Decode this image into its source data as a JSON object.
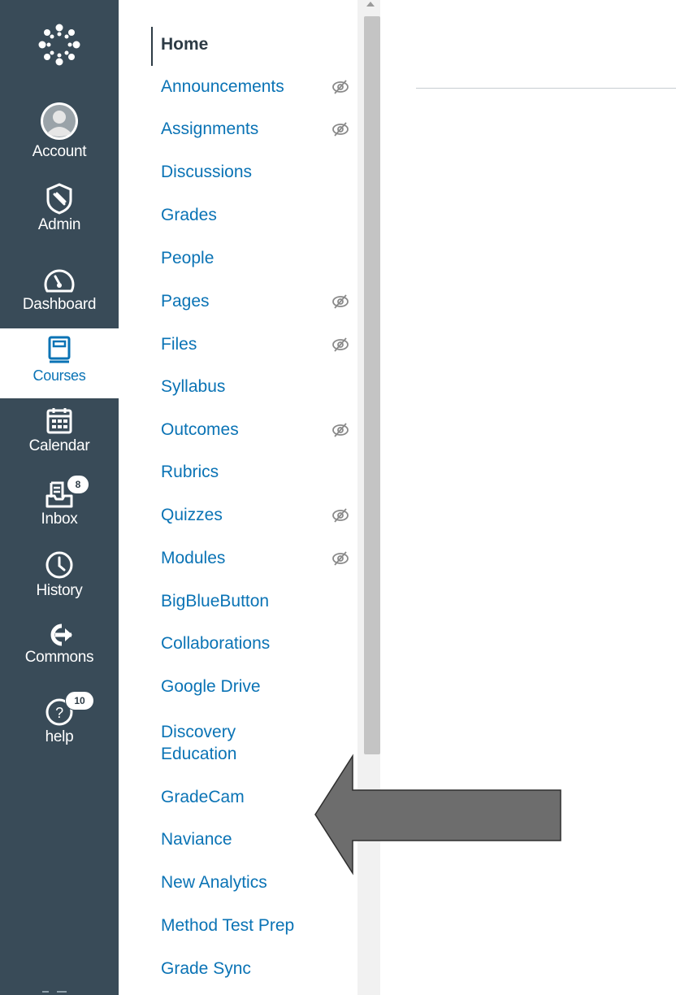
{
  "global_nav": {
    "items": [
      {
        "label": ""
      },
      {
        "label": "Account"
      },
      {
        "label": "Admin"
      },
      {
        "label": "Dashboard"
      },
      {
        "label": "Courses"
      },
      {
        "label": "Calendar"
      },
      {
        "label": "Inbox",
        "badge": "8"
      },
      {
        "label": "History"
      },
      {
        "label": "Commons"
      },
      {
        "label": "help",
        "badge": "10"
      }
    ],
    "colors": {
      "background": "#394b58",
      "active_bg": "#ffffff",
      "active_text": "#0a73b5"
    }
  },
  "course_nav": {
    "items": [
      {
        "label": "Home",
        "active": true,
        "hidden": false
      },
      {
        "label": "Announcements",
        "hidden": true
      },
      {
        "label": "Assignments",
        "hidden": true
      },
      {
        "label": "Discussions",
        "hidden": false
      },
      {
        "label": "Grades",
        "hidden": false
      },
      {
        "label": "People",
        "hidden": false
      },
      {
        "label": "Pages",
        "hidden": true
      },
      {
        "label": "Files",
        "hidden": true
      },
      {
        "label": "Syllabus",
        "hidden": false
      },
      {
        "label": "Outcomes",
        "hidden": true
      },
      {
        "label": "Rubrics",
        "hidden": false
      },
      {
        "label": "Quizzes",
        "hidden": true
      },
      {
        "label": "Modules",
        "hidden": true
      },
      {
        "label": "BigBlueButton",
        "hidden": false
      },
      {
        "label": "Collaborations",
        "hidden": false
      },
      {
        "label": "Google Drive",
        "hidden": false
      },
      {
        "label": "Discovery",
        "hidden": false
      },
      {
        "label": "Education",
        "hidden": false
      },
      {
        "label": "GradeCam",
        "hidden": false
      },
      {
        "label": "Naviance",
        "hidden": false
      },
      {
        "label": "New Analytics",
        "hidden": false
      },
      {
        "label": "Method Test Prep",
        "hidden": false
      },
      {
        "label": "Grade Sync",
        "hidden": false
      }
    ],
    "link_color": "#0a73b5",
    "hidden_icon": "eye-slash-icon"
  },
  "annotation": {
    "shape": "left-arrow",
    "color": "#6d6d6d"
  }
}
